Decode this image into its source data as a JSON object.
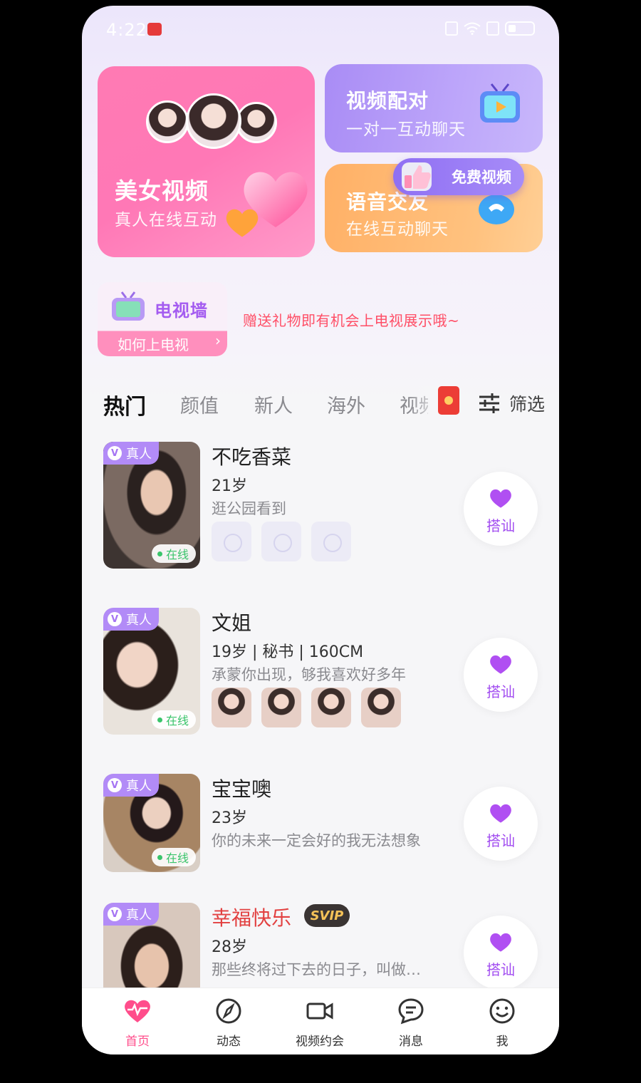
{
  "status_bar": {
    "time": "4:22"
  },
  "banners": {
    "beauty_video": {
      "title": "美女视频",
      "subtitle": "真人在线互动"
    },
    "video_match": {
      "title": "视频配对",
      "subtitle": "一对一互动聊天"
    },
    "voice_chat": {
      "title": "语音交友",
      "subtitle": "在线互动聊天"
    },
    "free_video_badge": "免费视频"
  },
  "tv_wall": {
    "title": "电视墙",
    "link": "如何上电视",
    "notice": "赠送礼物即有机会上电视展示哦~"
  },
  "tabs": {
    "items": [
      "热门",
      "颜值",
      "新人",
      "海外",
      "视频"
    ],
    "active": "热门",
    "filter_label": "筛选"
  },
  "badges": {
    "verified": "真人",
    "online": "在线",
    "svip": "SVIP"
  },
  "chat_button_label": "搭讪",
  "users": [
    {
      "name": "不吃香菜",
      "info": "21岁",
      "bio": "逛公园看到",
      "thumbs": "placeholder"
    },
    {
      "name": "文姐",
      "info": "19岁 | 秘书 | 160CM",
      "bio": "承蒙你出现，够我喜欢好多年",
      "thumbs": "photos"
    },
    {
      "name": "宝宝噢",
      "info": "23岁",
      "bio": "你的未来一定会好的我无法想象"
    },
    {
      "name": "幸福快乐",
      "info": "28岁",
      "bio": "那些终将过下去的日子，叫做…",
      "vip": true
    }
  ],
  "bottom_nav": {
    "items": [
      {
        "label": "首页",
        "icon": "heart-pulse-icon"
      },
      {
        "label": "动态",
        "icon": "compass-icon"
      },
      {
        "label": "视频约会",
        "icon": "video-camera-icon"
      },
      {
        "label": "消息",
        "icon": "chat-bubble-icon"
      },
      {
        "label": "我",
        "icon": "smile-face-icon"
      }
    ],
    "active": "首页"
  },
  "colors": {
    "accent_pink": "#ff4d8b",
    "purple": "#a14cf0",
    "notice_red": "#ff4e66",
    "online_green": "#39c46a"
  }
}
